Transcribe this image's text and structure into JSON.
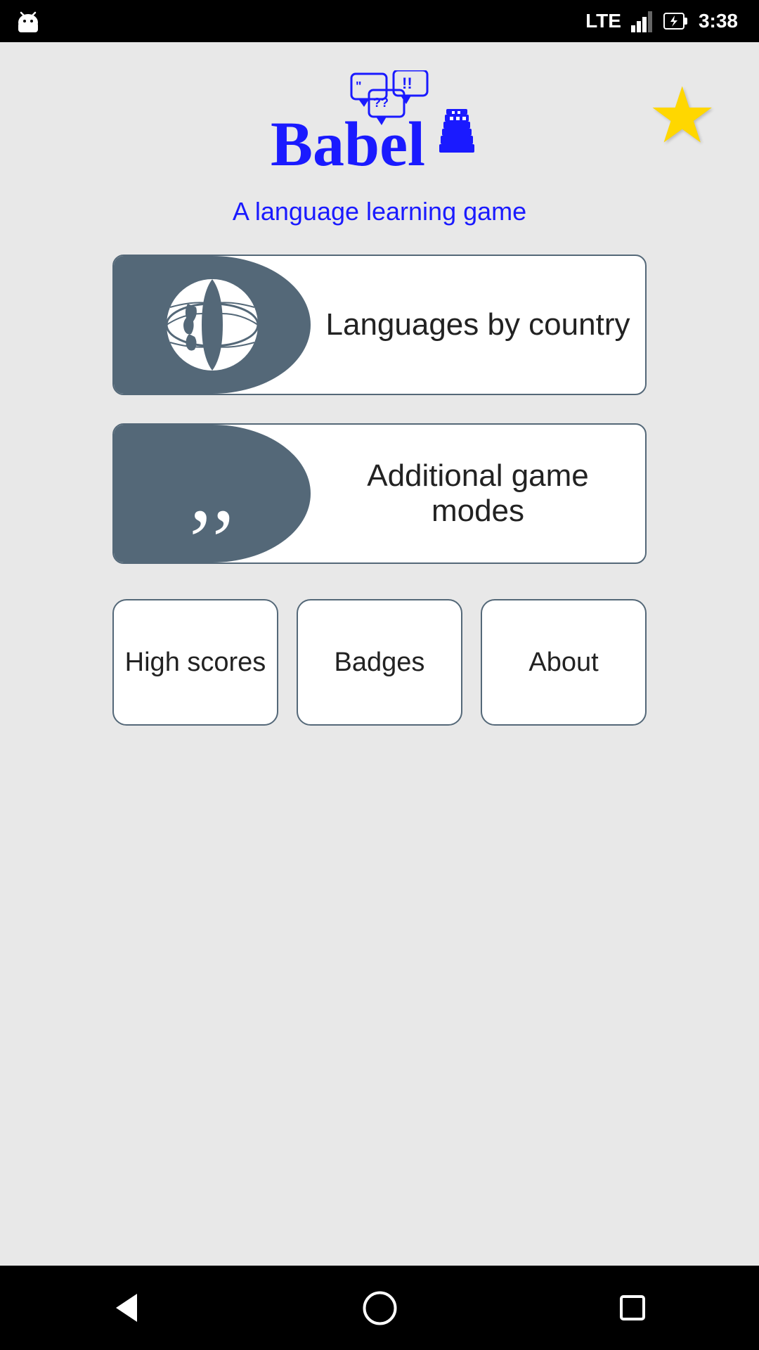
{
  "statusBar": {
    "time": "3:38",
    "signal": "LTE"
  },
  "header": {
    "logoAlt": "Babel - A language learning game",
    "subtitle": "A language learning game",
    "starLabel": "favorites-star"
  },
  "buttons": {
    "languagesByCountry": "Languages by\ncountry",
    "additionalGameModes": "Additional game modes",
    "highScores": "High scores",
    "badges": "Badges",
    "about": "About"
  },
  "navBar": {
    "back": "back",
    "home": "home",
    "recents": "recents"
  }
}
